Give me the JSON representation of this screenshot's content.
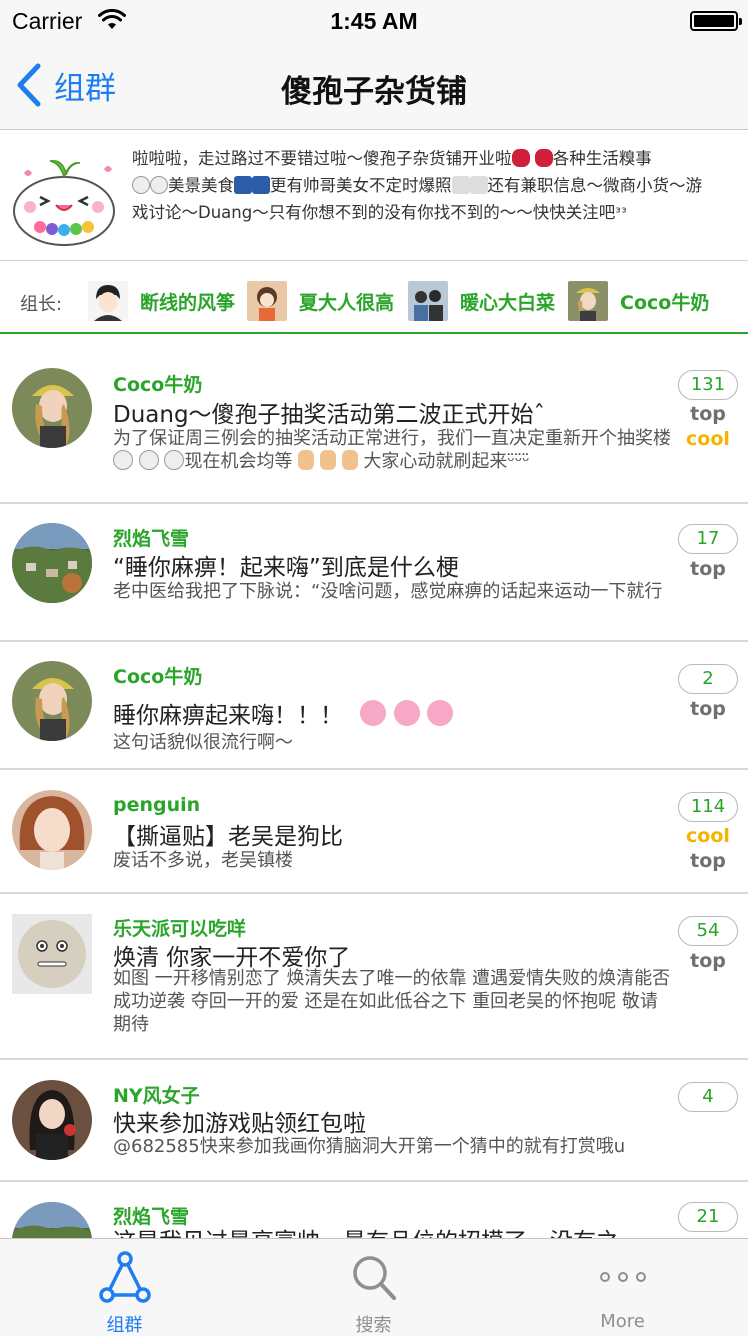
{
  "status_bar": {
    "carrier": "Carrier",
    "time": "1:45 AM"
  },
  "nav": {
    "back_label": "组群",
    "title": "傻孢子杂货铺"
  },
  "group": {
    "description_1": "啦啦啦，走过路过不要错过啦～傻孢子杂货铺开业啦",
    "description_2": "各种生活糗事",
    "description_3": "美景美食",
    "description_4": "更有帅哥美女不定时爆照",
    "description_5": "还有兼职信息～微商小货～游戏讨论～Duang～只有你想不到的没有你找不到的～～快快关注吧ᵌᵌ",
    "leaders_label": "组长:",
    "leaders": [
      {
        "name": "断线的风筝"
      },
      {
        "name": "夏大人很高"
      },
      {
        "name": "暖心大白菜"
      },
      {
        "name": "Coco牛奶"
      }
    ]
  },
  "topics": [
    {
      "author": "Coco牛奶",
      "title": "Duang～傻孢子抽奖活动第二波正式开始ˆ",
      "summary_1": "为了保证周三例会的抽奖活动正常进行，我们一直决定重新开个抽奖楼",
      "summary_2": "现在机会均等",
      "summary_3": "大家心动就刷起来ᵕ̈ᵕ̈ᵕ̈",
      "count": "131",
      "tags": [
        "top",
        "cool"
      ]
    },
    {
      "author": "烈焰飞雪",
      "title": "“睡你麻痹！起来嗨”到底是什么梗",
      "summary": "老中医给我把了下脉说：“没啥问题，感觉麻痹的话起来运动一下就行",
      "count": "17",
      "tags": [
        "top"
      ]
    },
    {
      "author": "Coco牛奶",
      "title": "睡你麻痹起来嗨！！！",
      "summary": "这句话貌似很流行啊～",
      "count": "2",
      "tags": [
        "top"
      ]
    },
    {
      "author": "penguin",
      "title": "【撕逼贴】老吴是狗比",
      "summary": "废话不多说，老吴镇楼",
      "count": "114",
      "tags": [
        "cool",
        "top"
      ]
    },
    {
      "author": "乐天派可以吃咩",
      "title": "焕清 你家一开不爱你了",
      "summary": "如图 一开移情别恋了 焕清失去了唯一的依靠 遭遇爱情失败的焕清能否成功逆袭 夺回一开的爱 还是在如此低谷之下 重回老吴的怀抱呢 敬请期待",
      "count": "54",
      "tags": [
        "top"
      ]
    },
    {
      "author": "NY风女子",
      "title": "快来参加游戏贴领红包啦",
      "summary": "@682585快来参加我画你猜脑洞大开第一个猜中的就有打赏哦u",
      "count": "4",
      "tags": []
    },
    {
      "author": "烈焰飞雪",
      "title": "这是我见过最高富帅，最有品位的招模了，没有之",
      "count": "21",
      "tags": []
    }
  ],
  "tab_bar": {
    "tabs": [
      {
        "label": "组群",
        "icon": "triangle-nodes-icon",
        "active": true
      },
      {
        "label": "搜索",
        "icon": "search-icon",
        "active": false
      },
      {
        "label": "More",
        "icon": "more-dots-icon",
        "active": false
      }
    ]
  },
  "colors": {
    "accent_blue": "#1e7ef0",
    "author_green": "#2aa52a",
    "cool_yellow": "#f5b400",
    "top_gray": "#707070"
  }
}
